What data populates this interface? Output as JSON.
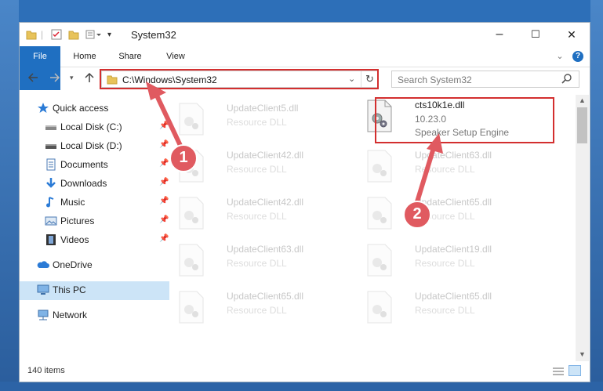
{
  "window": {
    "title": "System32",
    "controls": {
      "minimize": "–",
      "maximize": "☐",
      "close": "✕"
    }
  },
  "ribbon": {
    "tabs": [
      "File",
      "Home",
      "Share",
      "View"
    ],
    "collapse_chevron": "⌄",
    "help": "?"
  },
  "address": {
    "path": "C:\\Windows\\System32",
    "search_placeholder": "Search System32"
  },
  "nav": {
    "quick_access": "Quick access",
    "items": [
      {
        "label": "Local Disk (C:)"
      },
      {
        "label": "Local Disk (D:)"
      },
      {
        "label": "Documents"
      },
      {
        "label": "Downloads"
      },
      {
        "label": "Music"
      },
      {
        "label": "Pictures"
      },
      {
        "label": "Videos"
      }
    ],
    "onedrive": "OneDrive",
    "this_pc": "This PC",
    "network": "Network"
  },
  "files": {
    "left": [
      {
        "name": "UpdateClient5.dll",
        "meta": "Resource DLL"
      },
      {
        "name": "UpdateClient42.dll",
        "meta": "Resource DLL"
      },
      {
        "name": "UpdateClient42.dll",
        "meta": "Resource DLL"
      },
      {
        "name": "UpdateClient63.dll",
        "meta": "Resource DLL"
      },
      {
        "name": "UpdateClient65.dll",
        "meta": "Resource DLL"
      }
    ],
    "highlighted": {
      "name": "cts10k1e.dll",
      "version": "10.23.0",
      "description": "Speaker Setup Engine"
    },
    "right": [
      {
        "name": "UpdateClient63.dll",
        "meta": "Resource DLL"
      },
      {
        "name": "UpdateClient65.dll",
        "meta": "Resource DLL"
      },
      {
        "name": "UpdateClient19.dll",
        "meta": "Resource DLL"
      },
      {
        "name": "UpdateClient65.dll",
        "meta": "Resource DLL"
      }
    ]
  },
  "status": {
    "count": "140 items"
  },
  "annotations": {
    "badge1": "1",
    "badge2": "2",
    "color": "#e05a60"
  }
}
